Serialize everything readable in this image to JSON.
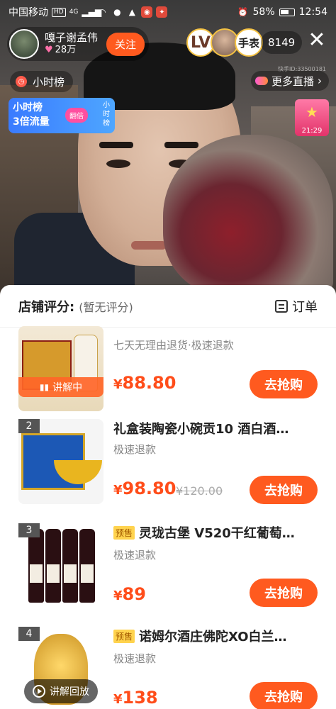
{
  "status_bar": {
    "carrier": "中国移动",
    "hd": "HD",
    "network": "4G",
    "battery": "58%",
    "time": "12:54"
  },
  "streamer": {
    "name": "嘎子谢孟伟",
    "likes": "28万",
    "follow_label": "关注"
  },
  "viewers": {
    "avatar1_text": "LV",
    "avatar3_text": "手表",
    "count": "8149"
  },
  "rank": {
    "label": "小时榜"
  },
  "more_live": {
    "label": "更多直播",
    "chevron": "›"
  },
  "watermark": "快手ID:33500181",
  "traffic_banner": {
    "line1": "小时榜",
    "line2": "3倍流量",
    "button": "翻倍",
    "tag": "小时榜"
  },
  "gift": {
    "time": "21:29"
  },
  "shop": {
    "rating_label": "店铺评分:",
    "rating_value": "(暂无评分)",
    "orders_label": "订单"
  },
  "products": [
    {
      "title": "",
      "sub": "七天无理由退货·极速退款",
      "price": "88.80",
      "old_price": "",
      "buy_label": "去抢购",
      "explaining_label": "讲解中",
      "badge": ""
    },
    {
      "badge": "2",
      "title": "礼盒装陶瓷小碗贡10 酒白酒…",
      "sub": "极速退款",
      "price": "98.80",
      "old_price": "¥120.00",
      "buy_label": "去抢购"
    },
    {
      "badge": "3",
      "presale": "预售",
      "title": "灵珑古堡 V520干红葡萄…",
      "sub": "极速退款",
      "price": "89",
      "old_price": "",
      "buy_label": "去抢购"
    },
    {
      "badge": "4",
      "presale": "预售",
      "title": "诺姆尔酒庄佛陀XO白兰…",
      "sub": "极速退款",
      "price": "138",
      "old_price": "",
      "buy_label": "去抢购"
    }
  ],
  "currency_symbol": "¥",
  "replay": {
    "label": "讲解回放"
  },
  "colors": {
    "accent": "#ff5a1f",
    "price": "#ff4d1a",
    "banner": "#3a7bff"
  }
}
